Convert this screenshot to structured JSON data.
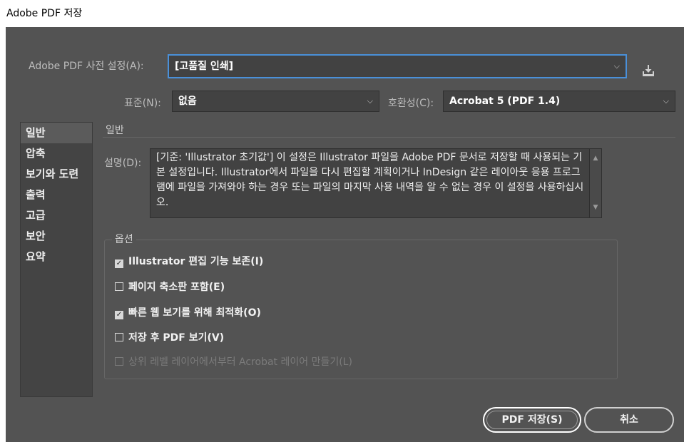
{
  "window": {
    "title": "Adobe PDF 저장"
  },
  "preset": {
    "label": "Adobe PDF 사전 설정(A):",
    "value": "[고품질 인쇄]"
  },
  "standard": {
    "label": "표준(N):",
    "value": "없음"
  },
  "compat": {
    "label": "호환성(C):",
    "value": "Acrobat 5 (PDF 1.4)"
  },
  "sidebar": {
    "items": [
      {
        "label": "일반"
      },
      {
        "label": "압축"
      },
      {
        "label": "보기와 도련"
      },
      {
        "label": "출력"
      },
      {
        "label": "고급"
      },
      {
        "label": "보안"
      },
      {
        "label": "요약"
      }
    ]
  },
  "main": {
    "section_title": "일반",
    "desc_label": "설명(D):",
    "description": "[기준: 'Illustrator 초기값'] 이 설정은 Illustrator 파일을 Adobe PDF 문서로 저장할 때 사용되는 기본 설정입니다. Illustrator에서 파일을 다시 편집할 계획이거나 InDesign 같은 레이아웃 응용 프로그램에 파일을 가져와야 하는 경우 또는 파일의 마지막 사용 내역을 알 수 없는 경우 이 설정을 사용하십시오.",
    "options_title": "옵션",
    "options": [
      {
        "label": "Illustrator 편집 기능 보존(I)",
        "checked": true
      },
      {
        "label": "페이지 축소판 포함(E)",
        "checked": false
      },
      {
        "label": "빠른 웹 보기를 위해 최적화(O)",
        "checked": true
      },
      {
        "label": "저장 후 PDF 보기(V)",
        "checked": false
      },
      {
        "label": "상위 레벨 레이어에서부터 Acrobat 레이어 만들기(L)",
        "checked": false,
        "disabled": true
      }
    ]
  },
  "buttons": {
    "save": "PDF 저장(S)",
    "cancel": "취소"
  },
  "icons": {
    "save_preset": "save-preset-icon",
    "dropdown": "chevron-down-icon",
    "check": "checkmark-icon"
  },
  "colors": {
    "background": "#535353",
    "field": "#424242",
    "focus": "#4a90d9"
  }
}
